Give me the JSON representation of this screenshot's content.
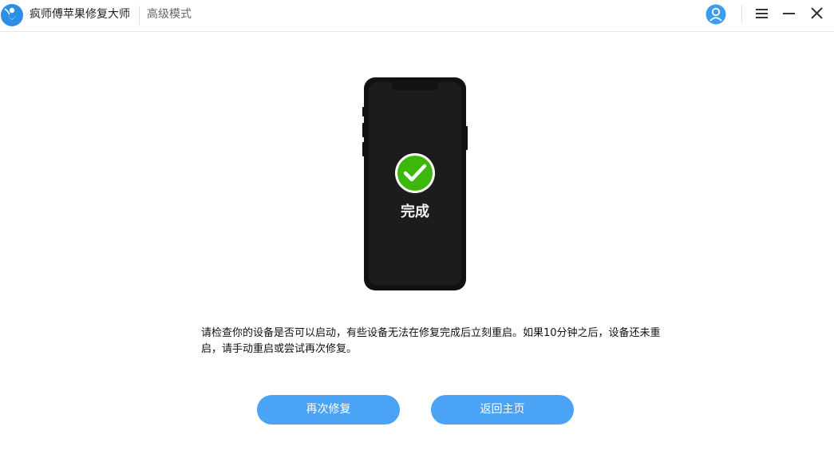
{
  "app": {
    "title": "疯师傅苹果修复大师",
    "mode": "高级模式"
  },
  "colors": {
    "accent": "#4aa3f5",
    "success": "#3cb80c",
    "phone_body": "#111111",
    "phone_screen": "#1c1c1c"
  },
  "icons": {
    "logo": "app-logo-icon",
    "user": "user-avatar-icon",
    "menu": "hamburger-menu-icon",
    "minimize": "minimize-icon",
    "close": "close-icon",
    "status": "check-circle-icon"
  },
  "status": {
    "title": "完成",
    "message": "请检查你的设备是否可以启动，有些设备无法在修复完成后立刻重启。如果10分钟之后，设备还未重启，请手动重启或尝试再次修复。"
  },
  "buttons": {
    "retry": "再次修复",
    "home": "返回主页"
  }
}
